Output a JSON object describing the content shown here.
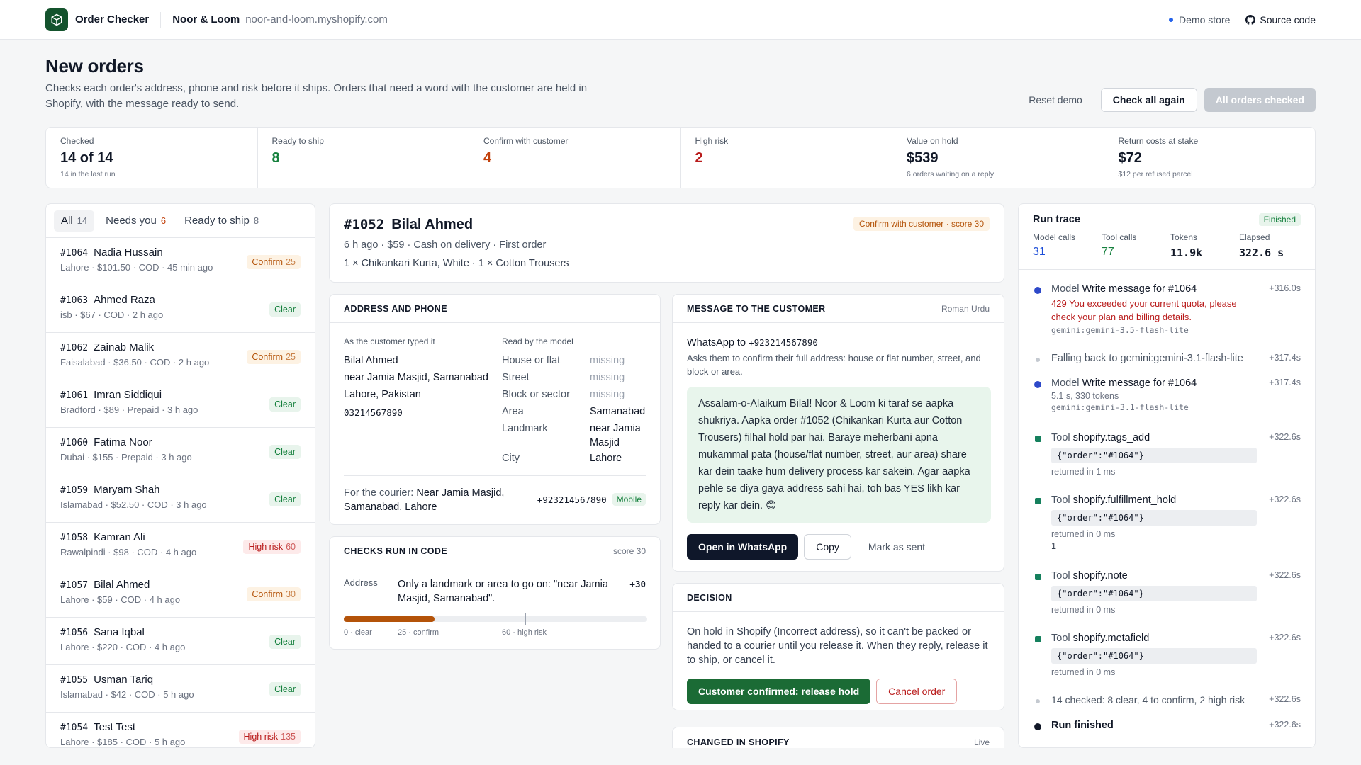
{
  "topbar": {
    "app_name": "Order Checker",
    "store_name": "Noor & Loom",
    "store_url": "noor-and-loom.myshopify.com",
    "demo_label": "Demo store",
    "source_label": "Source code"
  },
  "header": {
    "title": "New orders",
    "description": "Checks each order's address, phone and risk before it ships. Orders that need a word with the customer are held in Shopify, with the message ready to send.",
    "reset_label": "Reset demo",
    "check_again_label": "Check all again",
    "all_checked_label": "All orders checked"
  },
  "stats": [
    {
      "label": "Checked",
      "value": "14 of 14",
      "sub": "14 in the last run",
      "color": "#111827"
    },
    {
      "label": "Ready to ship",
      "value": "8",
      "sub": "",
      "color": "#15803d"
    },
    {
      "label": "Confirm with customer",
      "value": "4",
      "sub": "",
      "color": "#c2410c"
    },
    {
      "label": "High risk",
      "value": "2",
      "sub": "",
      "color": "#b91c1c"
    },
    {
      "label": "Value on hold",
      "value": "$539",
      "sub": "6 orders waiting on a reply",
      "color": "#111827"
    },
    {
      "label": "Return costs at stake",
      "value": "$72",
      "sub": "$12 per refused parcel",
      "color": "#111827"
    }
  ],
  "tabs": [
    {
      "label": "All",
      "count": "14"
    },
    {
      "label": "Needs you",
      "count": "6"
    },
    {
      "label": "Ready to ship",
      "count": "8"
    }
  ],
  "orders": [
    {
      "id": "#1064",
      "name": "Nadia Hussain",
      "meta": "Lahore · $101.50 · COD · 45 min ago",
      "badge": "Confirm",
      "score": "25",
      "kind": "confirm"
    },
    {
      "id": "#1063",
      "name": "Ahmed Raza",
      "meta": "isb · $67 · COD · 2 h ago",
      "badge": "Clear",
      "score": "",
      "kind": "clear"
    },
    {
      "id": "#1062",
      "name": "Zainab Malik",
      "meta": "Faisalabad · $36.50 · COD · 2 h ago",
      "badge": "Confirm",
      "score": "25",
      "kind": "confirm"
    },
    {
      "id": "#1061",
      "name": "Imran Siddiqui",
      "meta": "Bradford · $89 · Prepaid · 3 h ago",
      "badge": "Clear",
      "score": "",
      "kind": "clear"
    },
    {
      "id": "#1060",
      "name": "Fatima Noor",
      "meta": "Dubai · $155 · Prepaid · 3 h ago",
      "badge": "Clear",
      "score": "",
      "kind": "clear"
    },
    {
      "id": "#1059",
      "name": "Maryam Shah",
      "meta": "Islamabad · $52.50 · COD · 3 h ago",
      "badge": "Clear",
      "score": "",
      "kind": "clear"
    },
    {
      "id": "#1058",
      "name": "Kamran Ali",
      "meta": "Rawalpindi · $98 · COD · 4 h ago",
      "badge": "High risk",
      "score": "60",
      "kind": "risk"
    },
    {
      "id": "#1057",
      "name": "Bilal Ahmed",
      "meta": "Lahore · $59 · COD · 4 h ago",
      "badge": "Confirm",
      "score": "30",
      "kind": "confirm"
    },
    {
      "id": "#1056",
      "name": "Sana Iqbal",
      "meta": "Lahore · $220 · COD · 4 h ago",
      "badge": "Clear",
      "score": "",
      "kind": "clear"
    },
    {
      "id": "#1055",
      "name": "Usman Tariq",
      "meta": "Islamabad · $42 · COD · 5 h ago",
      "badge": "Clear",
      "score": "",
      "kind": "clear"
    },
    {
      "id": "#1054",
      "name": "Test Test",
      "meta": "Lahore · $185 · COD · 5 h ago",
      "badge": "High risk",
      "score": "135",
      "kind": "risk"
    }
  ],
  "detail": {
    "id": "#1052",
    "name": "Bilal Ahmed",
    "sub": "6 h ago · $59 · Cash on delivery · First order",
    "items": "1 × Chikankari Kurta, White · 1 × Cotton Trousers",
    "score_badge": "Confirm with customer · score 30"
  },
  "address": {
    "title": "ADDRESS AND PHONE",
    "typed_label": "As the customer typed it",
    "model_label": "Read by the model",
    "typed": [
      "Bilal Ahmed",
      "near Jamia Masjid, Samanabad",
      "Lahore, Pakistan"
    ],
    "typed_phone": "03214567890",
    "fields": [
      {
        "k": "House or flat",
        "v": "missing",
        "missing": true
      },
      {
        "k": "Street",
        "v": "missing",
        "missing": true
      },
      {
        "k": "Block or sector",
        "v": "missing",
        "missing": true
      },
      {
        "k": "Area",
        "v": "Samanabad",
        "missing": false
      },
      {
        "k": "Landmark",
        "v": "near Jamia Masjid",
        "missing": false
      },
      {
        "k": "City",
        "v": "Lahore",
        "missing": false
      }
    ],
    "courier_label": "For the courier:",
    "courier_value": "Near Jamia Masjid, Samanabad, Lahore",
    "courier_phone": "+923214567890",
    "phone_type": "Mobile"
  },
  "checks": {
    "title": "CHECKS RUN IN CODE",
    "score": "score 30",
    "row_label": "Address",
    "row_text": "Only a landmark or area to go on: \"near Jamia Masjid, Samanabad\".",
    "row_points": "+30",
    "bar_value": 30,
    "bar_max": 100,
    "scale": [
      "0 · clear",
      "25 · confirm",
      "60 · high risk"
    ]
  },
  "message": {
    "title": "MESSAGE TO THE CUSTOMER",
    "language": "Roman Urdu",
    "to_label": "WhatsApp to",
    "to_phone": "+923214567890",
    "purpose": "Asks them to confirm their full address: house or flat number, street, and block or area.",
    "body": "Assalam-o-Alaikum Bilal! Noor & Loom ki taraf se aapka shukriya. Aapka order #1052 (Chikankari Kurta aur Cotton Trousers) filhal hold par hai. Baraye meherbani apna mukammal pata (house/flat number, street, aur area) share kar dein taake hum delivery process kar sakein. Agar aapka pehle se diya gaya address sahi hai, toh bas YES likh kar reply kar dein. 😊",
    "open_label": "Open in WhatsApp",
    "copy_label": "Copy",
    "sent_label": "Mark as sent"
  },
  "decision": {
    "title": "DECISION",
    "text": "On hold in Shopify (Incorrect address), so it can't be packed or handed to a courier until you release it. When they reply, release it to ship, or cancel it.",
    "release_label": "Customer confirmed: release hold",
    "cancel_label": "Cancel order"
  },
  "changed": {
    "title": "CHANGED IN SHOPIFY",
    "tag": "Live"
  },
  "trace": {
    "title": "Run trace",
    "status": "Finished",
    "metrics": [
      {
        "label": "Model calls",
        "value": "31"
      },
      {
        "label": "Tool calls",
        "value": "77"
      },
      {
        "label": "Tokens",
        "value": "11.9k"
      },
      {
        "label": "Elapsed",
        "value": "322.6 s"
      }
    ],
    "events": [
      {
        "kind": "Model",
        "text": "Write message for #1064",
        "time": "+316.0s",
        "error": "429 You exceeded your current quota, please check your plan and billing details.",
        "model": "gemini:gemini-3.5-flash-lite"
      },
      {
        "text": "Falling back to gemini:gemini-3.1-flash-lite",
        "time": "+317.4s"
      },
      {
        "kind": "Model",
        "text": "Write message for #1064",
        "time": "+317.4s",
        "sub": "5.1 s, 330 tokens",
        "model": "gemini:gemini-3.1-flash-lite"
      },
      {
        "kind": "Tool",
        "text": "shopify.tags_add",
        "time": "+322.6s",
        "code": "{\"order\":\"#1064\"}",
        "sub": "returned in 1 ms"
      },
      {
        "kind": "Tool",
        "text": "shopify.fulfillment_hold",
        "time": "+322.6s",
        "code": "{\"order\":\"#1064\"}",
        "sub": "returned in 0 ms",
        "extra": "1"
      },
      {
        "kind": "Tool",
        "text": "shopify.note",
        "time": "+322.6s",
        "code": "{\"order\":\"#1064\"}",
        "sub": "returned in 0 ms"
      },
      {
        "kind": "Tool",
        "text": "shopify.metafield",
        "time": "+322.6s",
        "code": "{\"order\":\"#1064\"}",
        "sub": "returned in 0 ms"
      },
      {
        "text": "14 checked: 8 clear, 4 to confirm, 2 high risk",
        "time": "+322.6s"
      },
      {
        "text": "Run finished",
        "time": "+322.6s"
      }
    ]
  }
}
